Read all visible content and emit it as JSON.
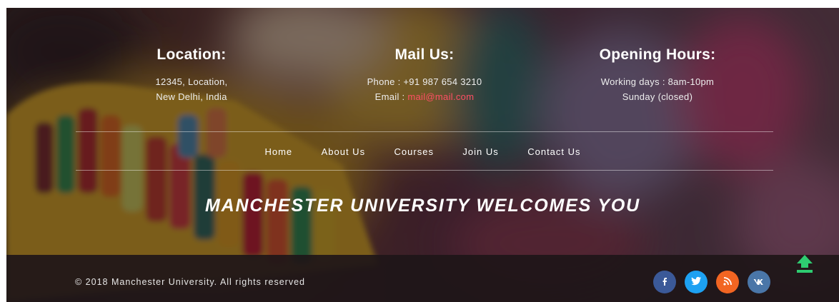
{
  "location": {
    "title": "Location:",
    "line1": "12345, Location,",
    "line2": "New Delhi, India"
  },
  "mail": {
    "title": "Mail Us:",
    "phone_label": "Phone : ",
    "phone": "+91 987 654 3210",
    "email_label": "Email : ",
    "email": "mail@mail.com"
  },
  "hours": {
    "title": "Opening Hours:",
    "line1": "Working days : 8am-10pm",
    "line2": "Sunday (closed)"
  },
  "nav": {
    "home": "Home",
    "about": "About Us",
    "courses": "Courses",
    "join": "Join Us",
    "contact": "Contact Us"
  },
  "welcome": "MANCHESTER UNIVERSITY WELCOMES YOU",
  "footer": {
    "copyright": "© 2018 Manchester University. All rights reserved"
  },
  "social": [
    {
      "name": "facebook-icon",
      "glyph": "f",
      "color": "#3b5998"
    },
    {
      "name": "twitter-icon",
      "glyph": "t",
      "color": "#1da1f2"
    },
    {
      "name": "rss-icon",
      "glyph": "r",
      "color": "#f26522"
    },
    {
      "name": "vk-icon",
      "glyph": "vk",
      "color": "#4a76a8"
    }
  ],
  "colors": {
    "accent": "#ff4f64",
    "totop": "#2ecc71"
  }
}
